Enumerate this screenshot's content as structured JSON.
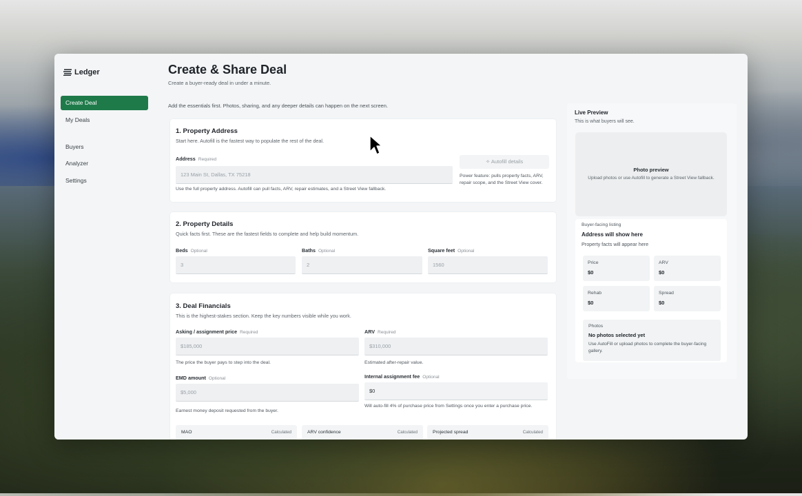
{
  "app": {
    "name": "Ledger"
  },
  "sidebar": {
    "items": [
      {
        "label": "Create Deal",
        "active": true
      },
      {
        "label": "My Deals"
      },
      {
        "label": "Buyers"
      },
      {
        "label": "Analyzer"
      },
      {
        "label": "Settings"
      }
    ]
  },
  "header": {
    "title": "Create & Share Deal",
    "subtitle": "Create a buyer-ready deal in under a minute.",
    "intro": "Add the essentials first. Photos, sharing, and any deeper details can happen on the next screen."
  },
  "address_section": {
    "title": "1. Property Address",
    "desc": "Start here. Autofill is the fastest way to populate the rest of the deal.",
    "address_label": "Address",
    "address_tag": "Required",
    "address_placeholder": "123 Main St, Dallas, TX 75218",
    "address_help": "Use the full property address. Autofill can pull facts, ARV, repair estimates, and a Street View fallback.",
    "autofill_label": "Autofill details",
    "autofill_note": "Power feature: pulls property facts, ARV, repair scope, and the Street View cover."
  },
  "details_section": {
    "title": "2. Property Details",
    "desc": "Quick facts first. These are the fastest fields to complete and help build momentum.",
    "beds_label": "Beds",
    "beds_tag": "Optional",
    "beds_placeholder": "3",
    "baths_label": "Baths",
    "baths_tag": "Optional",
    "baths_placeholder": "2",
    "sqft_label": "Square feet",
    "sqft_tag": "Optional",
    "sqft_placeholder": "1560"
  },
  "financials_section": {
    "title": "3. Deal Financials",
    "desc": "This is the highest-stakes section. Keep the key numbers visible while you work.",
    "asking_label": "Asking / assignment price",
    "asking_tag": "Required",
    "asking_placeholder": "$185,000",
    "asking_help": "The price the buyer pays to step into the deal.",
    "arv_label": "ARV",
    "arv_tag": "Required",
    "arv_placeholder": "$310,000",
    "arv_help": "Estimated after-repair value.",
    "emd_label": "EMD amount",
    "emd_tag": "Optional",
    "emd_placeholder": "$5,000",
    "emd_help": "Earnest money deposit requested from the buyer.",
    "fee_label": "Internal assignment fee",
    "fee_tag": "Optional",
    "fee_value": "$0",
    "fee_help": "Will auto-fill 4% of purchase price from Settings once you enter a purchase price.",
    "calculated": [
      {
        "name": "MAO",
        "tag": "Calculated"
      },
      {
        "name": "ARV confidence",
        "tag": "Calculated"
      },
      {
        "name": "Projected spread",
        "tag": "Calculated"
      }
    ]
  },
  "preview": {
    "title": "Live Preview",
    "subtitle": "This is what buyers will see.",
    "photo_title": "Photo preview",
    "photo_sub": "Upload photos or use Autofill to generate a Street View fallback.",
    "listing_label": "Buyer-facing listing",
    "address_placeholder": "Address will show here",
    "facts_placeholder": "Property facts will appear here",
    "stats": [
      {
        "k": "Price",
        "v": "$0"
      },
      {
        "k": "ARV",
        "v": "$0"
      },
      {
        "k": "Rehab",
        "v": "$0"
      },
      {
        "k": "Spread",
        "v": "$0"
      }
    ],
    "photos_label": "Photos",
    "photos_title": "No photos selected yet",
    "photos_desc": "Use AutoFill or upload photos to complete the buyer-facing gallery."
  },
  "colors": {
    "accent": "#1f7a4a",
    "bg": "#f3f5f6"
  },
  "icons": {
    "logo": "ledger-logo-icon",
    "autofill": "sparkle-icon",
    "cursor": "mouse-cursor-icon"
  }
}
